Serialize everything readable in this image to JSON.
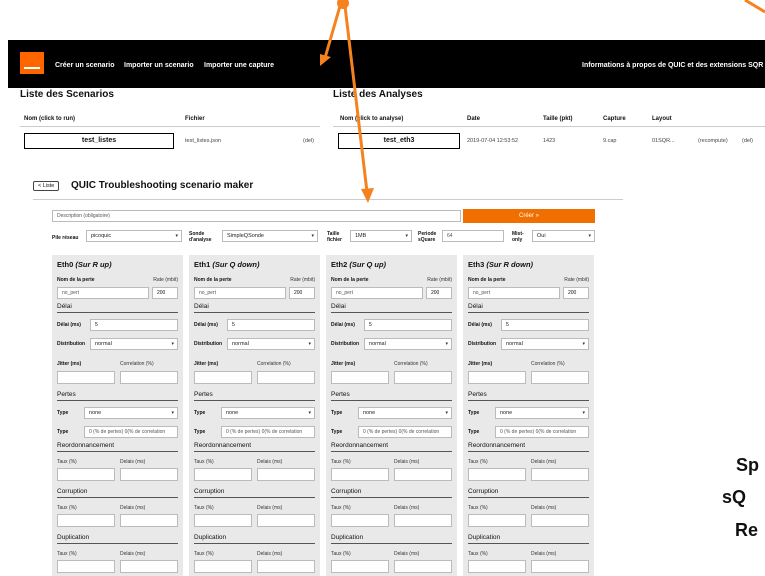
{
  "nav": {
    "links": [
      "Créer un scenario",
      "Importer un scenario",
      "Importer une capture"
    ],
    "right_link": "Informations à propos de QUIC et des extensions SQR"
  },
  "scenarios": {
    "title": "Liste des Scenarios",
    "headers": [
      "Nom (click to run)",
      "Fichier"
    ],
    "row": {
      "name": "test_listes",
      "file": "test_listes.json",
      "action": "(del)"
    }
  },
  "analyses": {
    "title": "Liste des Analyses",
    "headers": [
      "Nom (click to analyse)",
      "Date",
      "Taille (pkt)",
      "Capture",
      "Layout"
    ],
    "row": {
      "name": "test_eth3",
      "date": "2019-07-04 12:53:52",
      "size": "1423",
      "capture": "9.cap",
      "layout": "01SQR...",
      "recompute": "(recompute)",
      "del": "(del)"
    }
  },
  "maker": {
    "back_label": "< Liste",
    "title": "QUIC Troubleshooting scenario maker",
    "description_placeholder": "Description (obligatoire)",
    "create_label": "Créer »",
    "pile_label": "Pile réseau",
    "pile_value": "picoquic",
    "sonde_label": "Sonde d'analyse",
    "sonde_value": "SimpleQSonde",
    "taille_label": "Taille fichier",
    "taille_value": "1MB",
    "periode_label": "Periode sQuare",
    "periode_value": "64",
    "mist_label": "Mist-only",
    "mist_value": "Oui"
  },
  "columns": [
    {
      "name": "Eth0",
      "suffix": "(Sur R up)"
    },
    {
      "name": "Eth1",
      "suffix": "(Sur Q down)"
    },
    {
      "name": "Eth2",
      "suffix": "(Sur Q up)"
    },
    {
      "name": "Eth3",
      "suffix": "(Sur R down)"
    }
  ],
  "fields": {
    "loss_name_label": "Nom de la perte",
    "rate_label": "Rate (mbit)",
    "loss_name_placeholder": "no_pert",
    "rate_value": "200",
    "delai_section": "Délai",
    "delai_label": "Délai (ms)",
    "delai_value": "5",
    "distribution_label": "Distribution",
    "distribution_value": "normal",
    "jitter_label": "Jitter (ms)",
    "correlation_label": "Correlation (%)",
    "pertes_section": "Pertes",
    "type_label": "Type",
    "type_value": "none",
    "type2_value": "0 (% de pertes) 0(% de correlation",
    "reorder_section": "Reordonnancement",
    "taux_label": "Taux (%)",
    "delais_label": "Delais (ms)",
    "corruption_section": "Corruption",
    "duplication_section": "Duplication"
  },
  "side_text": [
    "Sp",
    "sQ",
    "Re"
  ],
  "colors": {
    "accent": "#f16e00",
    "navbar": "#000000",
    "panel": "#e9e9e9"
  }
}
